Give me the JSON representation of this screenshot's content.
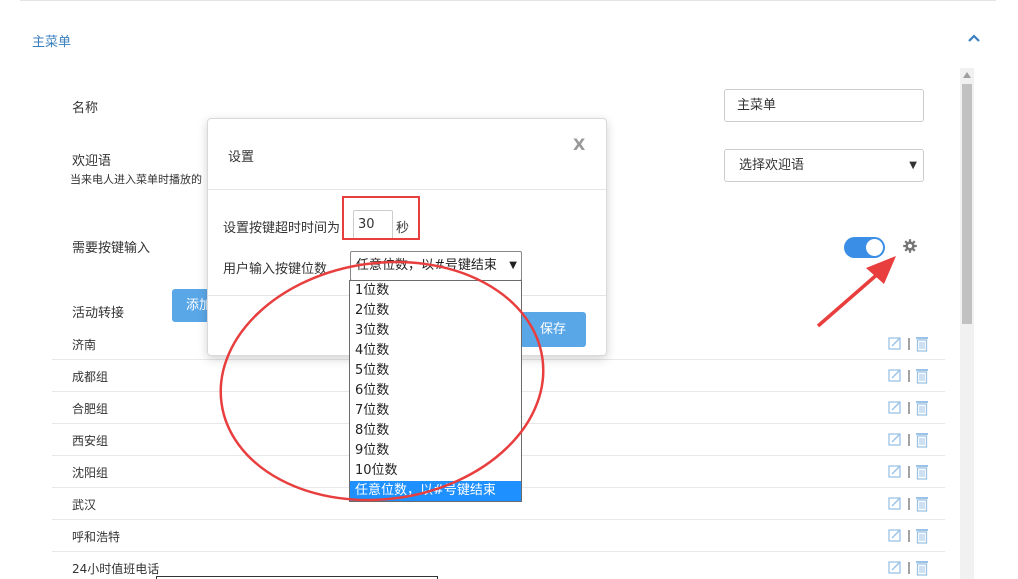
{
  "section": {
    "title": "主菜单"
  },
  "form": {
    "name_label": "名称",
    "name_value": "主菜单",
    "welcome_label": "欢迎语",
    "welcome_hint": "当来电人进入菜单时播放的",
    "welcome_select": "选择欢迎语",
    "key_input_label": "需要按键输入",
    "key_input_enabled": true,
    "transfer_label": "活动转接",
    "add_button": "添加"
  },
  "rows": [
    "济南",
    "成都组",
    "合肥组",
    "西安组",
    "沈阳组",
    "武汉",
    "呼和浩特",
    "24小时值班电话"
  ],
  "modal": {
    "title": "设置",
    "close": "X",
    "timeout_label": "设置按键超时时间为",
    "timeout_value": "30",
    "timeout_unit": "秒",
    "digits_label": "用户输入按键位数",
    "digits_selected": "任意位数，以#号键结束",
    "save": "保存"
  },
  "dropdown_options": [
    "1位数",
    "2位数",
    "3位数",
    "4位数",
    "5位数",
    "6位数",
    "7位数",
    "8位数",
    "9位数",
    "10位数",
    "任意位数，以#号键结束"
  ],
  "dropdown_selected_index": 10,
  "colors": {
    "accent": "#3a8ee6",
    "button": "#5aa7e8",
    "annotation": "#e83e3e",
    "selected_option": "#1e90ff"
  },
  "icons": {
    "collapse": "chevron-up-icon",
    "gear": "gear-icon",
    "edit": "edit-icon",
    "delete": "trash-icon"
  }
}
